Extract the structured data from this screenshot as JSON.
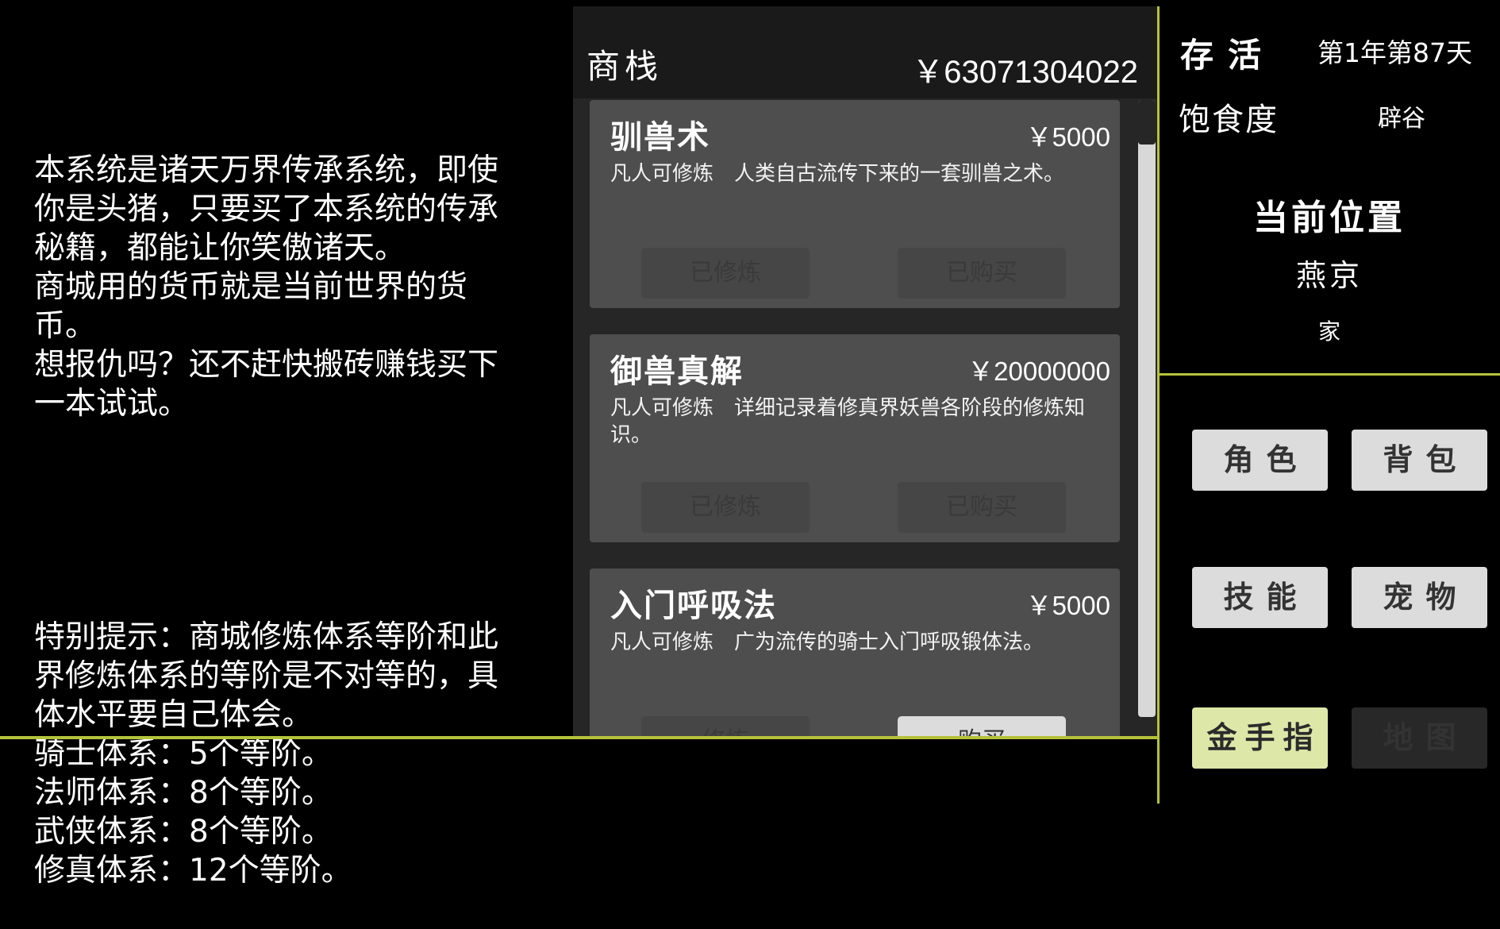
{
  "intro": {
    "paragraph1": "本系统是诸天万界传承系统，即使你是头猪，只要买了本系统的传承秘籍，都能让你笑傲诸天。\n商城用的货币就是当前世界的货币。\n想报仇吗？还不赶快搬砖赚钱买下一本试试。",
    "paragraph2": "特别提示：商城修炼体系等阶和此界修炼体系的等阶是不对等的，具体水平要自己体会。\n骑士体系：5个等阶。\n法师体系：8个等阶。\n武侠体系：8个等阶。\n修真体系：12个等阶。"
  },
  "shop": {
    "title": "商栈",
    "money": "￥63071304022",
    "scroll_position": 0.0,
    "items": [
      {
        "name": "驯兽术",
        "price": "￥5000",
        "description": "凡人可修炼　人类自古流传下来的一套驯兽之术。",
        "train_label": "已修炼",
        "train_enabled": false,
        "buy_label": "已购买",
        "buy_enabled": false
      },
      {
        "name": "御兽真解",
        "price": "￥20000000",
        "description": "凡人可修炼　详细记录着修真界妖兽各阶段的修炼知识。",
        "train_label": "已修炼",
        "train_enabled": false,
        "buy_label": "已购买",
        "buy_enabled": false
      },
      {
        "name": "入门呼吸法",
        "price": "￥5000",
        "description": "凡人可修炼　广为流传的骑士入门呼吸锻体法。",
        "train_label": "修炼",
        "train_enabled": false,
        "buy_label": "购买",
        "buy_enabled": true
      }
    ]
  },
  "status": {
    "survival_label": "存活",
    "date": "第1年第87天",
    "satiety_label": "饱食度",
    "satiety_value": "辟谷"
  },
  "location": {
    "title": "当前位置",
    "city": "燕京",
    "place": "家"
  },
  "menu": {
    "character": "角色",
    "backpack": "背包",
    "skills": "技能",
    "pets": "宠物",
    "golden_finger": "金手指",
    "map": "地图"
  },
  "colors": {
    "accent_line": "#b5c23a",
    "accent_button": "#dde7a8",
    "card_bg": "#4e4e4e"
  }
}
